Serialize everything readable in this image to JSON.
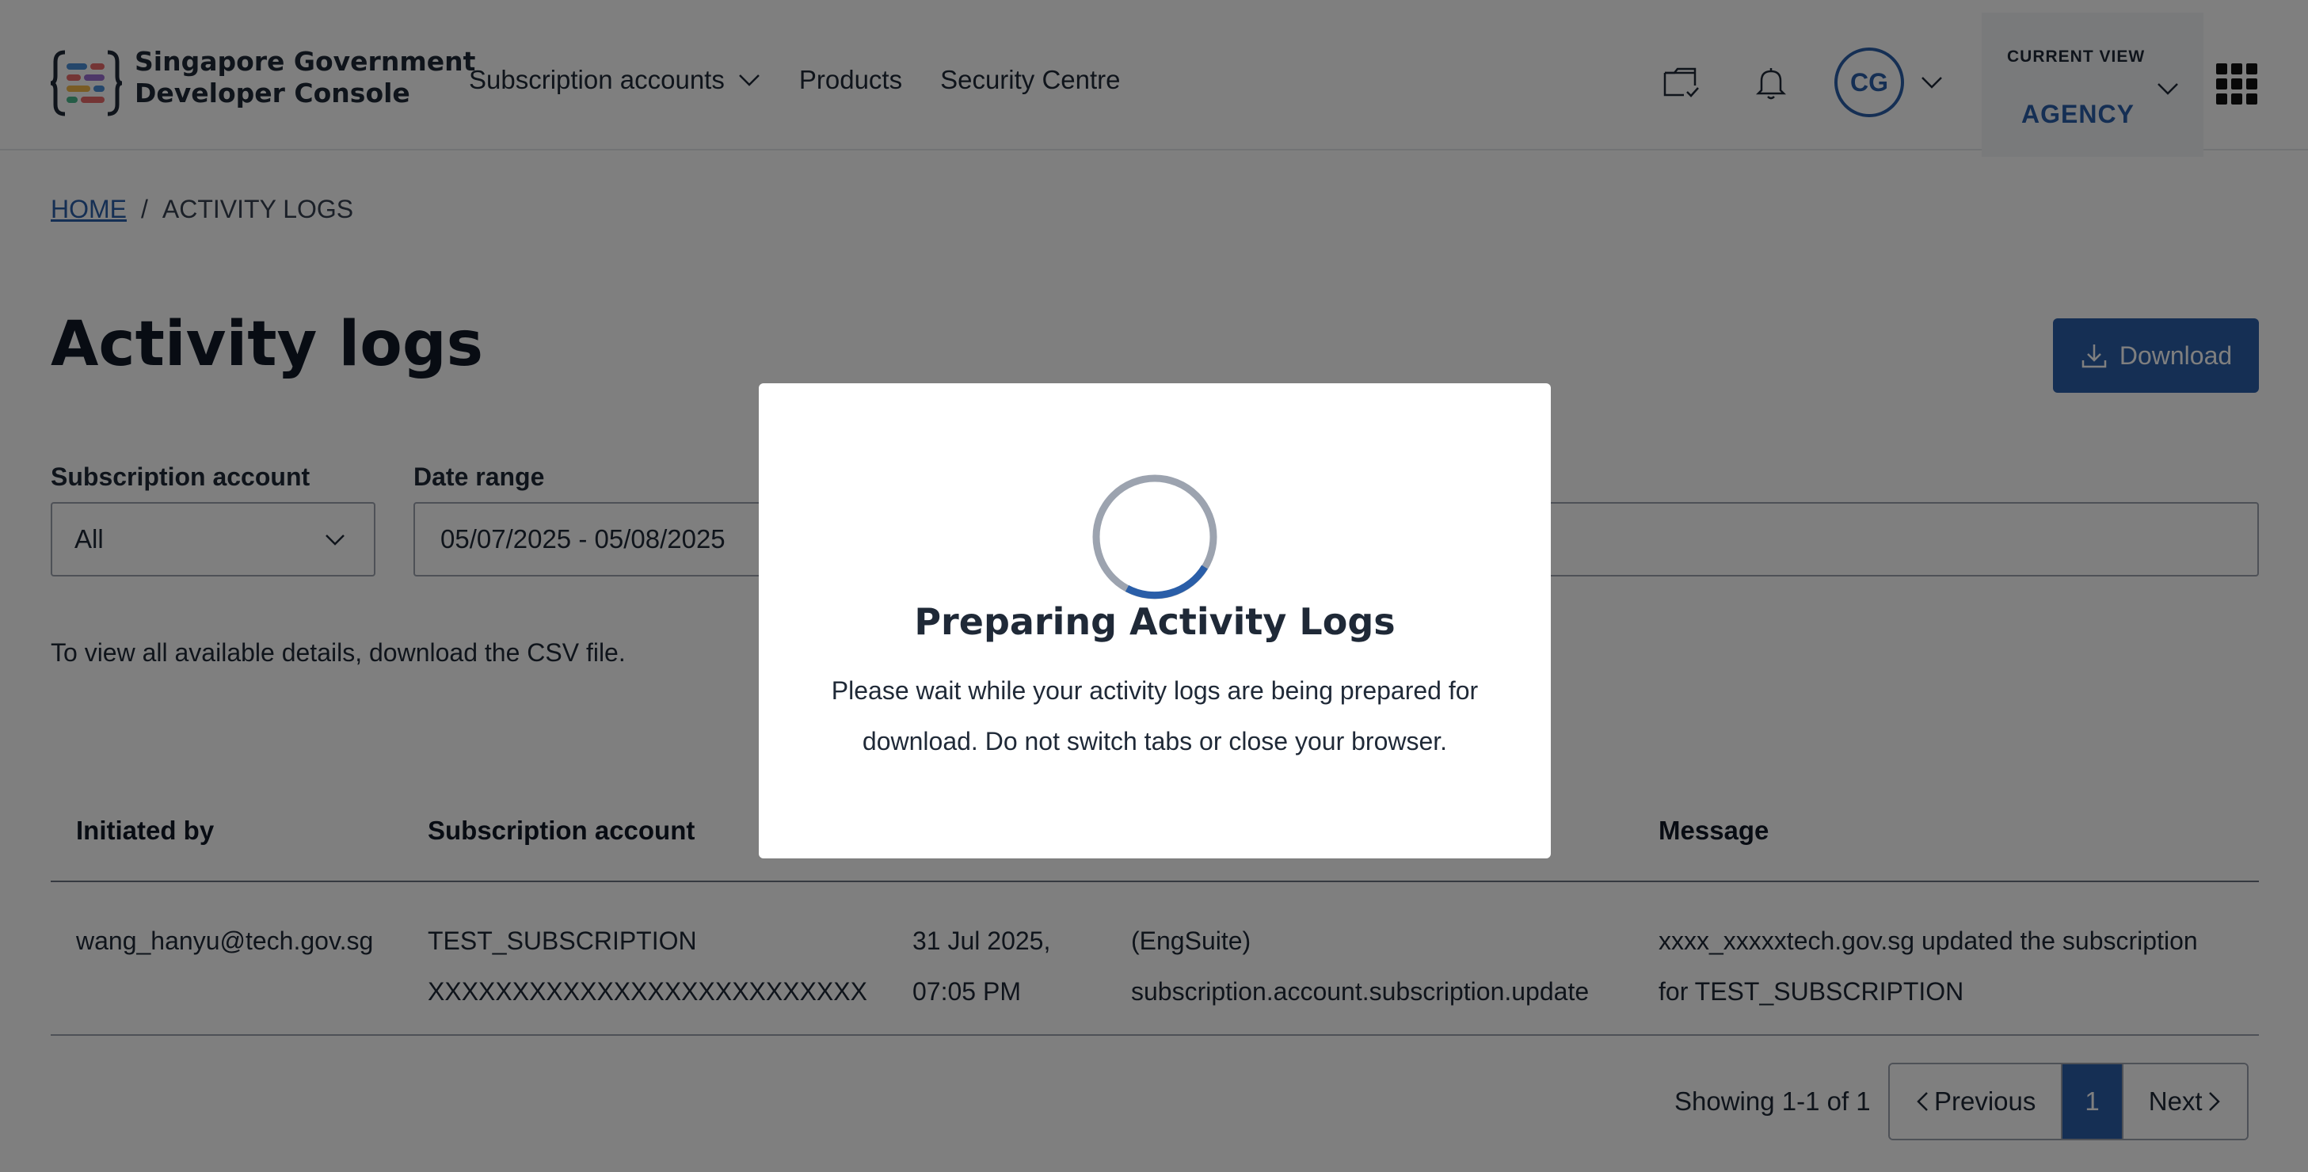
{
  "header": {
    "logo_line1": "Singapore Government",
    "logo_line2": "Developer Console",
    "nav": [
      {
        "label": "Subscription accounts"
      },
      {
        "label": "Products"
      },
      {
        "label": "Security Centre"
      }
    ],
    "avatar_initials": "CG",
    "current_view_label": "CURRENT VIEW",
    "current_view_value": "AGENCY"
  },
  "breadcrumb": {
    "home": "HOME",
    "separator": "/",
    "current": "ACTIVITY LOGS"
  },
  "page": {
    "title": "Activity logs",
    "download_label": "Download",
    "hint": "To view all available details, download the CSV file."
  },
  "filters": {
    "subscription_label": "Subscription account",
    "subscription_value": "All",
    "date_label": "Date range",
    "date_value": "05/07/2025 - 05/08/2025"
  },
  "table": {
    "headers": {
      "initiated_by": "Initiated by",
      "subscription_account": "Subscription account",
      "message": "Message"
    },
    "rows": [
      {
        "initiated_by": "wang_hanyu@tech.gov.sg",
        "subscription_line1": "TEST_SUBSCRIPTION",
        "subscription_line2": "XXXXXXXXXXXXXXXXXXXXXXXXXX",
        "date_line1": "31 Jul 2025,",
        "date_line2": "07:05 PM",
        "event_line1": "(EngSuite)",
        "event_line2": "subscription.account.subscription.update",
        "message_line1": "xxxx_xxxxxtech.gov.sg updated the subscription",
        "message_line2": "for TEST_SUBSCRIPTION"
      }
    ]
  },
  "pagination": {
    "showing": "Showing 1-1 of 1",
    "previous": "Previous",
    "current": "1",
    "next": "Next"
  },
  "modal": {
    "title": "Preparing Activity Logs",
    "body_line1": "Please wait while your activity logs are being prepared for",
    "body_line2": "download. Do not switch tabs or close your browser."
  },
  "colors": {
    "accent": "#2a5ea8",
    "overlay": "rgba(0,0,0,0.5)"
  }
}
